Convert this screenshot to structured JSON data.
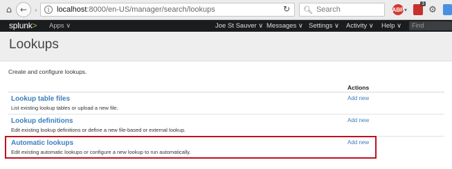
{
  "browser": {
    "url_host": "localhost",
    "url_path": ":8000/en-US/manager/search/lookups",
    "search_placeholder": "Search",
    "extension_badge": "3"
  },
  "splunk_nav": {
    "logo": "splunk",
    "logo_suffix": ">",
    "apps": "Apps ∨",
    "user": "Joe St Sauver ∨",
    "messages": "Messages ∨",
    "settings": "Settings ∨",
    "activity": "Activity ∨",
    "help": "Help ∨",
    "find_placeholder": "Find"
  },
  "page": {
    "title": "Lookups",
    "subtitle": "Create and configure lookups."
  },
  "table": {
    "actions_header": "Actions",
    "rows": [
      {
        "title": "Lookup table files",
        "description": "List existing lookup tables or upload a new file.",
        "action": "Add new"
      },
      {
        "title": "Lookup definitions",
        "description": "Edit existing lookup definitions or define a new file-based or external lookup.",
        "action": "Add new"
      },
      {
        "title": "Automatic lookups",
        "description": "Edit existing automatic lookups or configure a new lookup to run automatically.",
        "action": "Add new"
      }
    ]
  },
  "colors": {
    "link": "#3b7ebf",
    "highlight": "#c0101c",
    "splunk_bar": "#1a1c1e"
  }
}
